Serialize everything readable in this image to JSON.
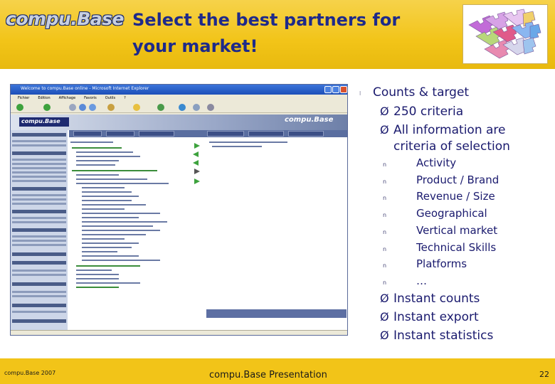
{
  "header": {
    "logo_text": "compu.Base",
    "title_line1": "Select the best partners for",
    "title_line2": "your market!",
    "colors": {
      "band": "#f2c418",
      "title": "#1e2a8a"
    }
  },
  "browser_screenshot": {
    "window_title": "Welcome to compu.Base online - Microsoft Internet Explorer",
    "menu": [
      "Fichier",
      "Edition",
      "Affichage",
      "Favoris",
      "Outils",
      "?"
    ]
  },
  "bullets": {
    "main": "Counts & target",
    "items": [
      {
        "arrow": "Ø",
        "text": "250 criteria"
      },
      {
        "arrow": "Ø",
        "text": "All information are"
      },
      {
        "arrow": "",
        "text": "criteria of selection"
      }
    ],
    "sub_marker": "n",
    "sub_items": [
      "Activity",
      "Product / Brand",
      "Revenue / Size",
      "Geographical",
      "Vertical market",
      "Technical Skills",
      "Platforms",
      "…"
    ],
    "items_after": [
      {
        "arrow": "Ø",
        "text": "Instant counts"
      },
      {
        "arrow": "Ø",
        "text": "Instant export"
      },
      {
        "arrow": "Ø",
        "text": "Instant statistics"
      }
    ]
  },
  "footer": {
    "left": "compu.Base 2007",
    "center": "compu.Base Presentation",
    "page": "22"
  }
}
